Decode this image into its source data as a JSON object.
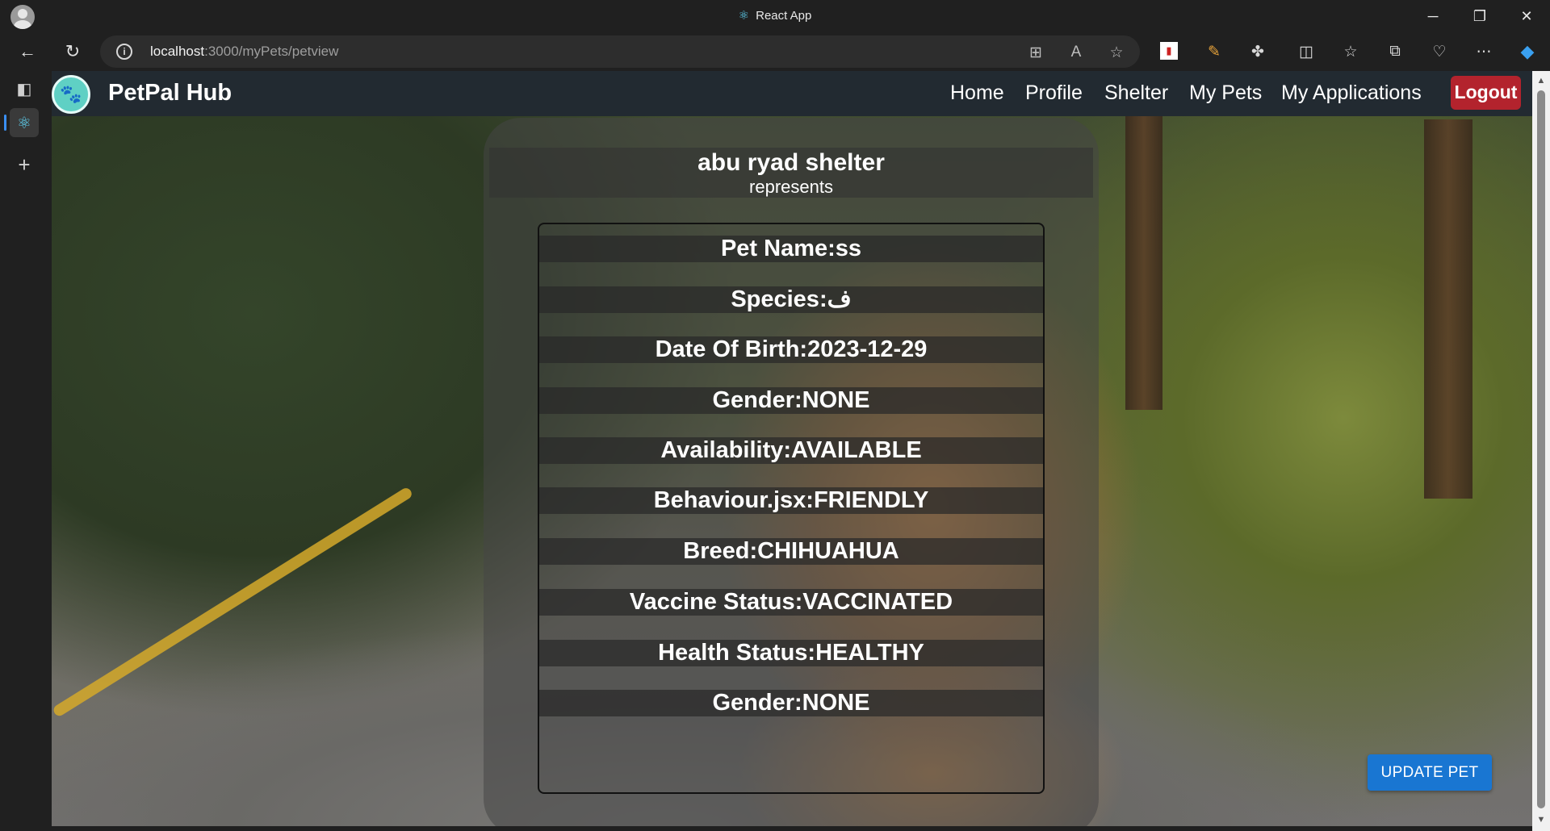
{
  "browser": {
    "window_title": "React App",
    "url_host": "localhost",
    "url_path": ":3000/myPets/petview"
  },
  "nav": {
    "brand": "PetPal Hub",
    "links": [
      "Home",
      "Profile",
      "Shelter",
      "My Pets",
      "My Applications"
    ],
    "logout": "Logout"
  },
  "shelter": {
    "name": "abu ryad shelter",
    "subtitle": "represents"
  },
  "pet_fields": [
    "Pet Name:ss",
    "Species:ف",
    "Date Of Birth:2023-12-29",
    "Gender:NONE",
    "Availability:AVAILABLE",
    "Behaviour.jsx:FRIENDLY",
    "Breed:CHIHUAHUA",
    "Vaccine Status:VACCINATED",
    "Health Status:HEALTHY",
    "Gender:NONE"
  ],
  "update_button": "UPDATE PET",
  "colors": {
    "navbar": "#222a31",
    "logout": "#b3232d",
    "update_button": "#1976d2",
    "logo": "#5fd0c4"
  }
}
